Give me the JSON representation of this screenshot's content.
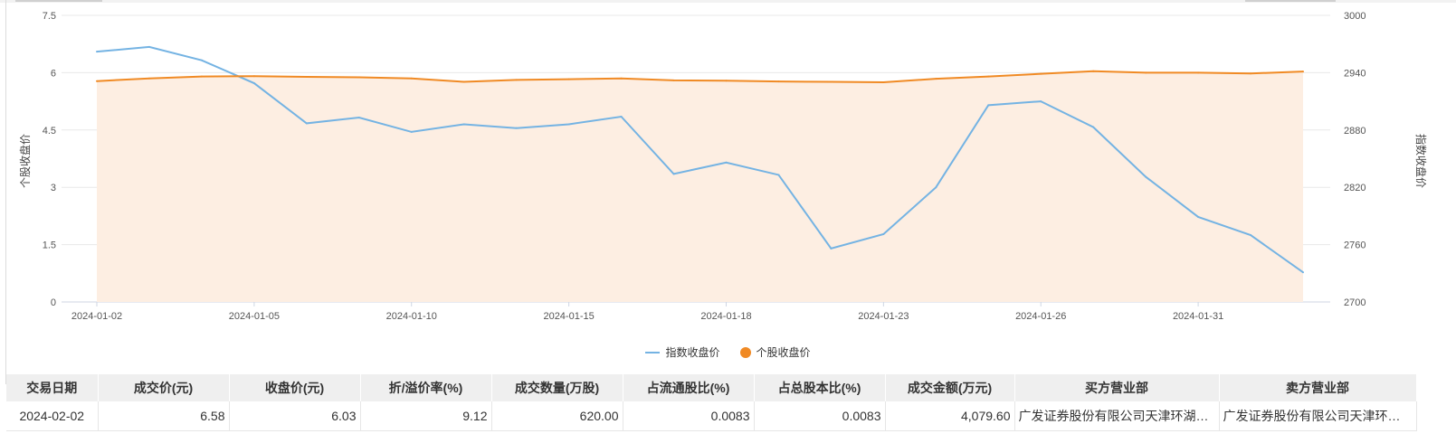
{
  "chart_data": {
    "type": "line",
    "x": [
      "2024-01-02",
      "2024-01-03",
      "2024-01-04",
      "2024-01-05",
      "2024-01-08",
      "2024-01-09",
      "2024-01-10",
      "2024-01-11",
      "2024-01-12",
      "2024-01-15",
      "2024-01-16",
      "2024-01-17",
      "2024-01-18",
      "2024-01-19",
      "2024-01-22",
      "2024-01-23",
      "2024-01-24",
      "2024-01-25",
      "2024-01-26",
      "2024-01-29",
      "2024-01-30",
      "2024-01-31",
      "2024-02-01",
      "2024-02-02"
    ],
    "x_tick_labels": [
      "2024-01-02",
      "2024-01-05",
      "2024-01-10",
      "2024-01-15",
      "2024-01-18",
      "2024-01-23",
      "2024-01-26",
      "2024-01-31"
    ],
    "y_left": {
      "label": "个股收盘价",
      "lim": [
        0,
        7.5
      ],
      "ticks": [
        "0",
        "1.5",
        "3",
        "4.5",
        "6",
        "7.5"
      ]
    },
    "y_right": {
      "label": "指数收盘价",
      "lim": [
        2700,
        3000
      ],
      "ticks": [
        "2700",
        "2760",
        "2820",
        "2880",
        "2940",
        "3000"
      ]
    },
    "series": [
      {
        "name": "指数收盘价",
        "axis": "right",
        "style": "line",
        "color": "#74b3e3",
        "values": [
          2962,
          2967,
          2953,
          2929,
          2887,
          2893,
          2878,
          2886,
          2882,
          2886,
          2894,
          2834,
          2846,
          2833,
          2756,
          2771,
          2820,
          2906,
          2910,
          2883,
          2831,
          2789,
          2770,
          2731
        ]
      },
      {
        "name": "个股收盘价",
        "axis": "left",
        "style": "area",
        "color": "#f08a24",
        "fill": "#fdeee2",
        "values": [
          5.78,
          5.85,
          5.9,
          5.91,
          5.89,
          5.88,
          5.85,
          5.76,
          5.81,
          5.83,
          5.85,
          5.8,
          5.79,
          5.77,
          5.76,
          5.75,
          5.84,
          5.9,
          5.97,
          6.04,
          6.0,
          6.0,
          5.98,
          6.03
        ]
      }
    ]
  },
  "legend": {
    "items": [
      {
        "label": "指数收盘价",
        "color": "#74b3e3"
      },
      {
        "label": "个股收盘价",
        "color": "#f08a24"
      }
    ]
  },
  "table": {
    "headers": [
      "交易日期",
      "成交价(元)",
      "收盘价(元)",
      "折/溢价率(%)",
      "成交数量(万股)",
      "占流通股比(%)",
      "占总股本比(%)",
      "成交金额(万元)",
      "买方营业部",
      "卖方营业部"
    ],
    "rows": [
      [
        "2024-02-02",
        "6.58",
        "6.03",
        "9.12",
        "620.00",
        "0.0083",
        "0.0083",
        "4,079.60",
        "广发证券股份有限公司天津环湖…",
        "广发证券股份有限公司天津环…"
      ]
    ]
  }
}
